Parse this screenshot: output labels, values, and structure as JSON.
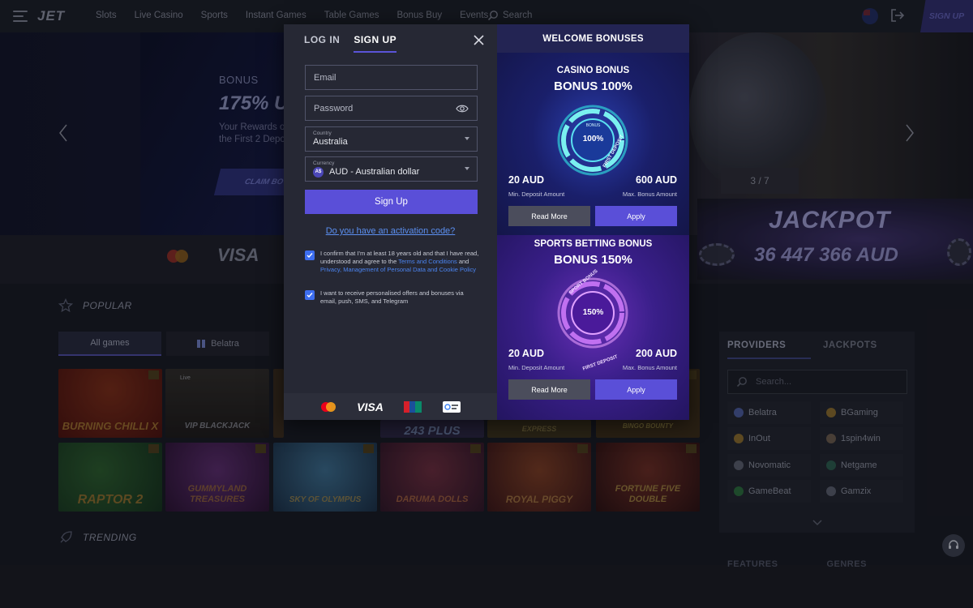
{
  "nav": {
    "logo": "JET",
    "links": [
      "Slots",
      "Live Casino",
      "Sports",
      "Instant Games",
      "Table Games",
      "Bonus Buy",
      "Events"
    ],
    "search_label": "Search",
    "signup_label": "SIGN UP"
  },
  "hero": {
    "eyebrow": "BONUS",
    "title": "175% U",
    "text_line1": "Your Rewards o",
    "text_line2": "the First 2 Depo",
    "claim_label": "CLAIM BO",
    "slide_counter": "3 / 7"
  },
  "payments": {
    "visa": "VISA"
  },
  "jackpot": {
    "title": "JACKPOT",
    "amount": "36 447 366 AUD"
  },
  "sections": {
    "popular": "POPULAR",
    "trending": "TRENDING"
  },
  "game_tabs": {
    "all": "All games",
    "belatra": "Belatra"
  },
  "games": [
    {
      "title": "BURNING CHILLI X",
      "bg": "#5a1a14"
    },
    {
      "title": "VIP BLACKJACK",
      "badge": "Live",
      "bg": "#2a2420"
    },
    {
      "title": "",
      "bg": "#3a2a1a"
    },
    {
      "title": "243 PLUS",
      "bg": "#3a2a40"
    },
    {
      "title": "EXPRESS",
      "bg": "#4a3a1a"
    },
    {
      "title": "BINGO BOUNTY",
      "bg": "#4a3014"
    },
    {
      "title": "RAPTOR 2",
      "bg": "#1e3a22"
    },
    {
      "title": "GUMMYLAND TREASURES",
      "bg": "#3a1a44"
    },
    {
      "title": "SKY OF OLYMPUS",
      "bg": "#1e3048"
    },
    {
      "title": "DARUMA DOLLS",
      "bg": "#3a1e34"
    },
    {
      "title": "ROYAL PIGGY",
      "bg": "#4a1e1e"
    },
    {
      "title": "FORTUNE FIVE DOUBLE",
      "bg": "#3a1414"
    }
  ],
  "providers": {
    "tab_providers": "PROVIDERS",
    "tab_jackpots": "JACKPOTS",
    "search_placeholder": "Search...",
    "items": [
      "Belatra",
      "BGaming",
      "InOut",
      "1spin4win",
      "Novomatic",
      "Netgame",
      "GameBeat",
      "Gamzix"
    ],
    "features": "FEATURES",
    "genres": "GENRES"
  },
  "modal": {
    "tab_login": "LOG IN",
    "tab_signup": "SIGN UP",
    "email_placeholder": "Email",
    "password_placeholder": "Password",
    "country_label": "Country",
    "country_value": "Australia",
    "currency_label": "Currency",
    "currency_symbol": "A$",
    "currency_value": "AUD - Australian dollar",
    "signup_button": "Sign Up",
    "activation_link": "Do you have an activation code?",
    "consent1_text1": "I confirm that I'm at least 18 years old and that I have read, understood and agree to the ",
    "consent1_link1": "Terms and Conditions",
    "consent1_text2": " and ",
    "consent1_link2": "Privacy, Management of Personal Data and Cookie Policy",
    "consent2_text": "I want to receive personalised offers and bonuses via email, push, SMS, and Telegram",
    "footer_visa": "VISA"
  },
  "welcome": {
    "header": "WELCOME BONUSES",
    "casino": {
      "type": "CASINO BONUS",
      "pct": "BONUS 100%",
      "ring_value": "100%",
      "ring_top": "BONUS",
      "ring_bottom": "FIRST DEPOSIT",
      "min_amount": "20 AUD",
      "min_label": "Min. Deposit Amount",
      "max_amount": "600 AUD",
      "max_label": "Max. Bonus Amount",
      "read_more": "Read More",
      "apply": "Apply"
    },
    "sports": {
      "type": "SPORTS BETTING BONUS",
      "pct": "BONUS 150%",
      "ring_value": "150%",
      "ring_top": "SPORT BONUS",
      "ring_bottom": "FIRST DEPOSIT",
      "min_amount": "20 AUD",
      "min_label": "Min. Deposit Amount",
      "max_amount": "200 AUD",
      "max_label": "Max. Bonus Amount",
      "read_more": "Read More",
      "apply": "Apply"
    }
  }
}
